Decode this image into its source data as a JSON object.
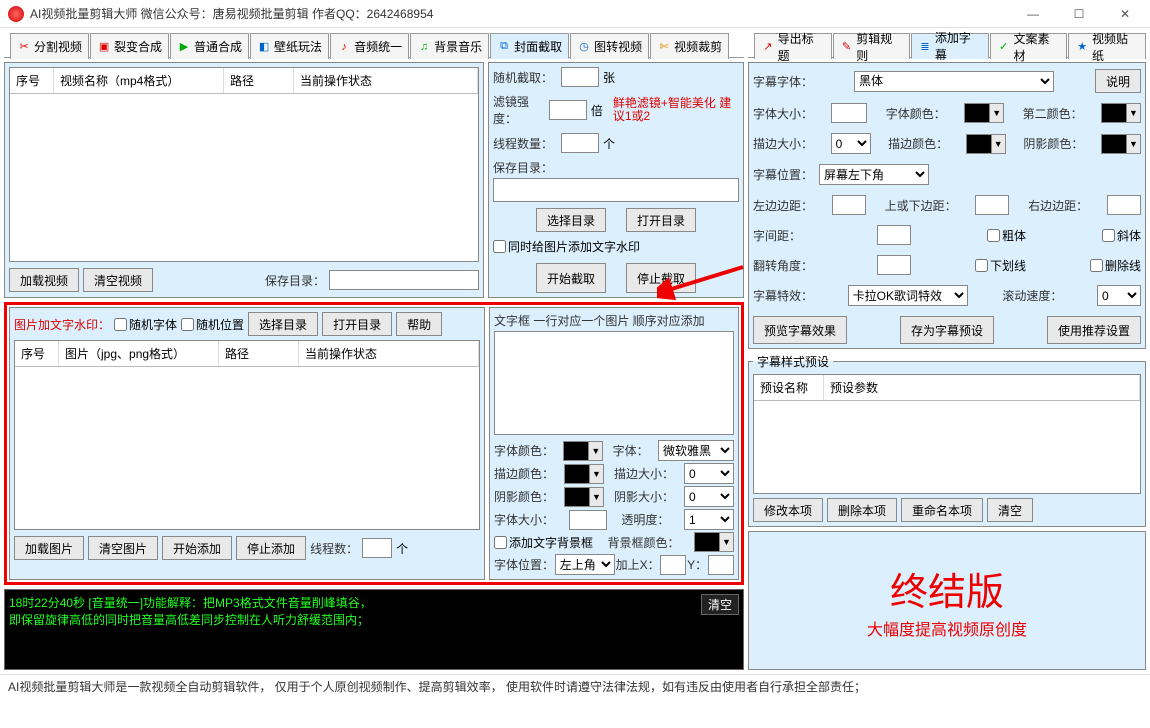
{
  "title": "AI视频批量剪辑大师    微信公众号：唐易视频批量剪辑     作者QQ：2642468954",
  "winbtns": {
    "min": "—",
    "max": "☐",
    "close": "✕"
  },
  "leftTabs": [
    {
      "ico": "✂",
      "color": "#d00",
      "label": "分割视频"
    },
    {
      "ico": "▣",
      "color": "#d00",
      "label": "裂变合成"
    },
    {
      "ico": "▶",
      "color": "#0a0",
      "label": "普通合成"
    },
    {
      "ico": "◧",
      "color": "#06c",
      "label": "壁纸玩法"
    },
    {
      "ico": "♪",
      "color": "#d00",
      "label": "音频统一"
    },
    {
      "ico": "♫",
      "color": "#0a0",
      "label": "背景音乐"
    },
    {
      "ico": "⧉",
      "color": "#06c",
      "label": "封面截取",
      "active": true
    },
    {
      "ico": "◷",
      "color": "#06c",
      "label": "图转视频"
    },
    {
      "ico": "✄",
      "color": "#d80",
      "label": "视频裁剪"
    }
  ],
  "rightTabs": [
    {
      "ico": "↗",
      "color": "#d00",
      "label": "导出标题"
    },
    {
      "ico": "✎",
      "color": "#d00",
      "label": "剪辑规则"
    },
    {
      "ico": "≣",
      "color": "#06c",
      "label": "添加字幕",
      "active": true
    },
    {
      "ico": "✓",
      "color": "#0a0",
      "label": "文案素材"
    },
    {
      "ico": "★",
      "color": "#06c",
      "label": "视频贴纸"
    }
  ],
  "videoGrid": {
    "cols": [
      "序号",
      "视频名称（mp4格式）",
      "路径",
      "当前操作状态"
    ]
  },
  "videoBtns": {
    "load": "加载视频",
    "clear": "清空视频",
    "saveDirLbl": "保存目录："
  },
  "imgGrid": {
    "cols": [
      "序号",
      "图片（jpg、png格式）",
      "路径",
      "当前操作状态"
    ]
  },
  "imgHeader": {
    "title": "图片加文字水印：",
    "randFont": "随机字体",
    "randPos": "随机位置",
    "choose": "选择目录",
    "open": "打开目录",
    "help": "帮助"
  },
  "imgBtns": {
    "load": "加载图片",
    "clear": "清空图片",
    "start": "开始添加",
    "stop": "停止添加",
    "threadsLbl": "线程数：",
    "unit": "个"
  },
  "captureHeader": {
    "cb": "同时给图片添加文字水印",
    "start": "开始截取",
    "stop": "停止截取"
  },
  "capture": {
    "randCutLbl": "随机截取：",
    "randCutUnit": "张",
    "filterLbl": "滤镜强度：",
    "filterUnit": "倍",
    "filterHint": "鲜艳滤镜+智能美化 建议1或2",
    "threadsLbl": "线程数量：",
    "threadsUnit": "个",
    "saveDirLbl": "保存目录：",
    "choose": "选择目录",
    "open": "打开目录"
  },
  "textbox": {
    "title": "文字框 一行对应一个图片 顺序对应添加",
    "fontColor": "字体颜色：",
    "font": "字体：",
    "fontVal": "微软雅黑",
    "strokeColor": "描边颜色：",
    "strokeSize": "描边大小：",
    "strokeVal": "0",
    "shadowColor": "阴影颜色：",
    "shadowSize": "阴影大小：",
    "shadowVal": "0",
    "fontSize": "字体大小：",
    "opacity": "透明度：",
    "opacityVal": "1",
    "bgCb": "添加文字背景框",
    "bgColor": "背景框颜色：",
    "fontPos": "字体位置：",
    "fontPosVal": "左上角",
    "addX": "加上X：",
    "y": "Y："
  },
  "subtitle": {
    "explain": "说明",
    "fontLbl": "字幕字体：",
    "fontVal": "黑体",
    "sizeLbl": "字体大小：",
    "colorLbl": "字体颜色：",
    "color2Lbl": "第二颜色：",
    "strokeLbl": "描边大小：",
    "strokeVal": "0",
    "strokeColorLbl": "描边颜色：",
    "shadowColorLbl": "阴影颜色：",
    "posLbl": "字幕位置：",
    "posVal": "屏幕左下角",
    "leftLbl": "左边边距：",
    "topLbl": "上或下边距：",
    "rightLbl": "右边边距：",
    "spacingLbl": "字间距：",
    "boldCb": "粗体",
    "italicCb": "斜体",
    "rotateLbl": "翻转角度：",
    "underlineCb": "下划线",
    "strikeCb": "删除线",
    "fxLbl": "字幕特效：",
    "fxVal": "卡拉OK歌词特效",
    "speedLbl": "滚动速度：",
    "speedVal": "0",
    "preview": "预览字幕效果",
    "savePreset": "存为字幕预设",
    "useRec": "使用推荐设置"
  },
  "preset": {
    "legend": "字幕样式预设",
    "cols": [
      "预设名称",
      "预设参数"
    ],
    "mod": "修改本项",
    "del": "删除本项",
    "ren": "重命名本项",
    "clear": "清空"
  },
  "ad": {
    "big": "终结版",
    "small": "大幅度提高视频原创度"
  },
  "log": {
    "clear": "清空",
    "line1": "18时22分40秒 [音量统一]功能解释：把MP3格式文件音量削峰填谷，",
    "line2": "    即保留旋律高低的同时把音量高低差同步控制在人听力舒缓范围内；"
  },
  "status": "AI视频批量剪辑大师是一款视频全自动剪辑软件，  仅用于个人原创视频制作、提高剪辑效率，  使用软件时请遵守法律法规，如有违反由使用者自行承担全部责任；"
}
